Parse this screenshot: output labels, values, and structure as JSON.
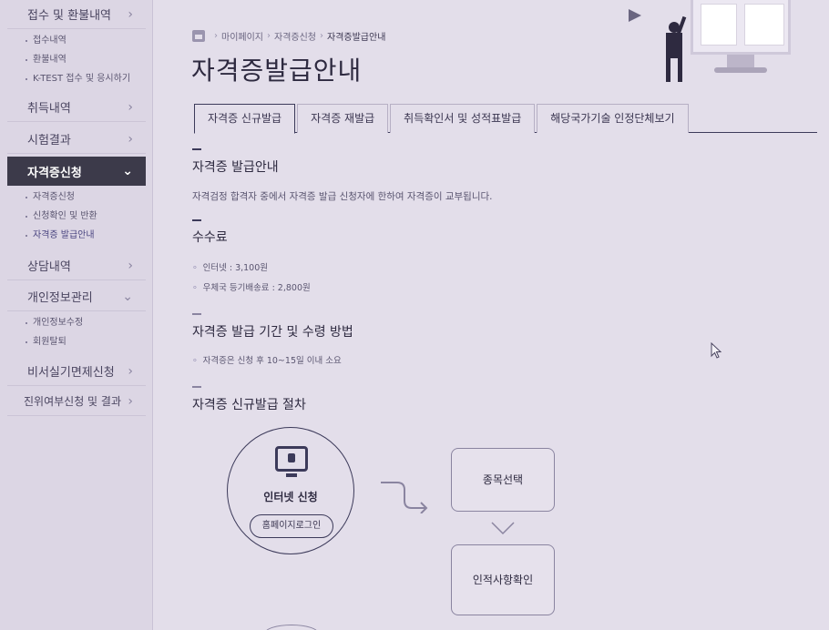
{
  "sidebar": {
    "items": [
      {
        "label": "접수 및 환불내역",
        "subitems": [
          "접수내역",
          "환불내역",
          "K-TEST 접수 및 응시하기"
        ]
      },
      {
        "label": "취득내역"
      },
      {
        "label": "시험결과"
      },
      {
        "label": "자격증신청",
        "active": true,
        "subitems": [
          "자격증신청",
          "신청확인 및 반환",
          "자격증 발급안내"
        ]
      },
      {
        "label": "상담내역"
      },
      {
        "label": "개인정보관리",
        "subitems": [
          "개인정보수정",
          "회원탈퇴"
        ]
      },
      {
        "label": "비서실기면제신청"
      },
      {
        "label": "진위여부신청 및 결과"
      }
    ]
  },
  "breadcrumb": {
    "home_icon": "home-icon",
    "items": [
      "마이페이지",
      "자격증신청",
      "자격증발급안내"
    ]
  },
  "page_title": "자격증발급안내",
  "tabs": [
    "자격증 신규발급",
    "자격증 재발급",
    "취득확인서 및 성적표발급",
    "해당국가기술 인정단체보기"
  ],
  "sections": {
    "guide": {
      "title": "자격증 발급안내",
      "text": "자격검정 합격자 중에서 자격증 발급 신청자에 한하여 자격증이 교부됩니다."
    },
    "fee": {
      "title": "수수료",
      "items": [
        "인터넷 : 3,100원",
        "우체국 등기배송료 : 2,800원"
      ]
    },
    "period": {
      "title": "자격증 발급 기간 및 수령 방법",
      "items": [
        "자격증은 신청 후 10~15일 이내 소요"
      ]
    },
    "procedure": {
      "title": "자격증 신규발급 절차",
      "step1_label": "인터넷 신청",
      "step1_button": "홈페이지로그인",
      "step2_label": "종목선택",
      "step3_label": "인적사항확인"
    }
  },
  "colors": {
    "accent": "#3c3a5a",
    "sidebar_active": "#3c3a4a",
    "background": "#e3deea"
  }
}
